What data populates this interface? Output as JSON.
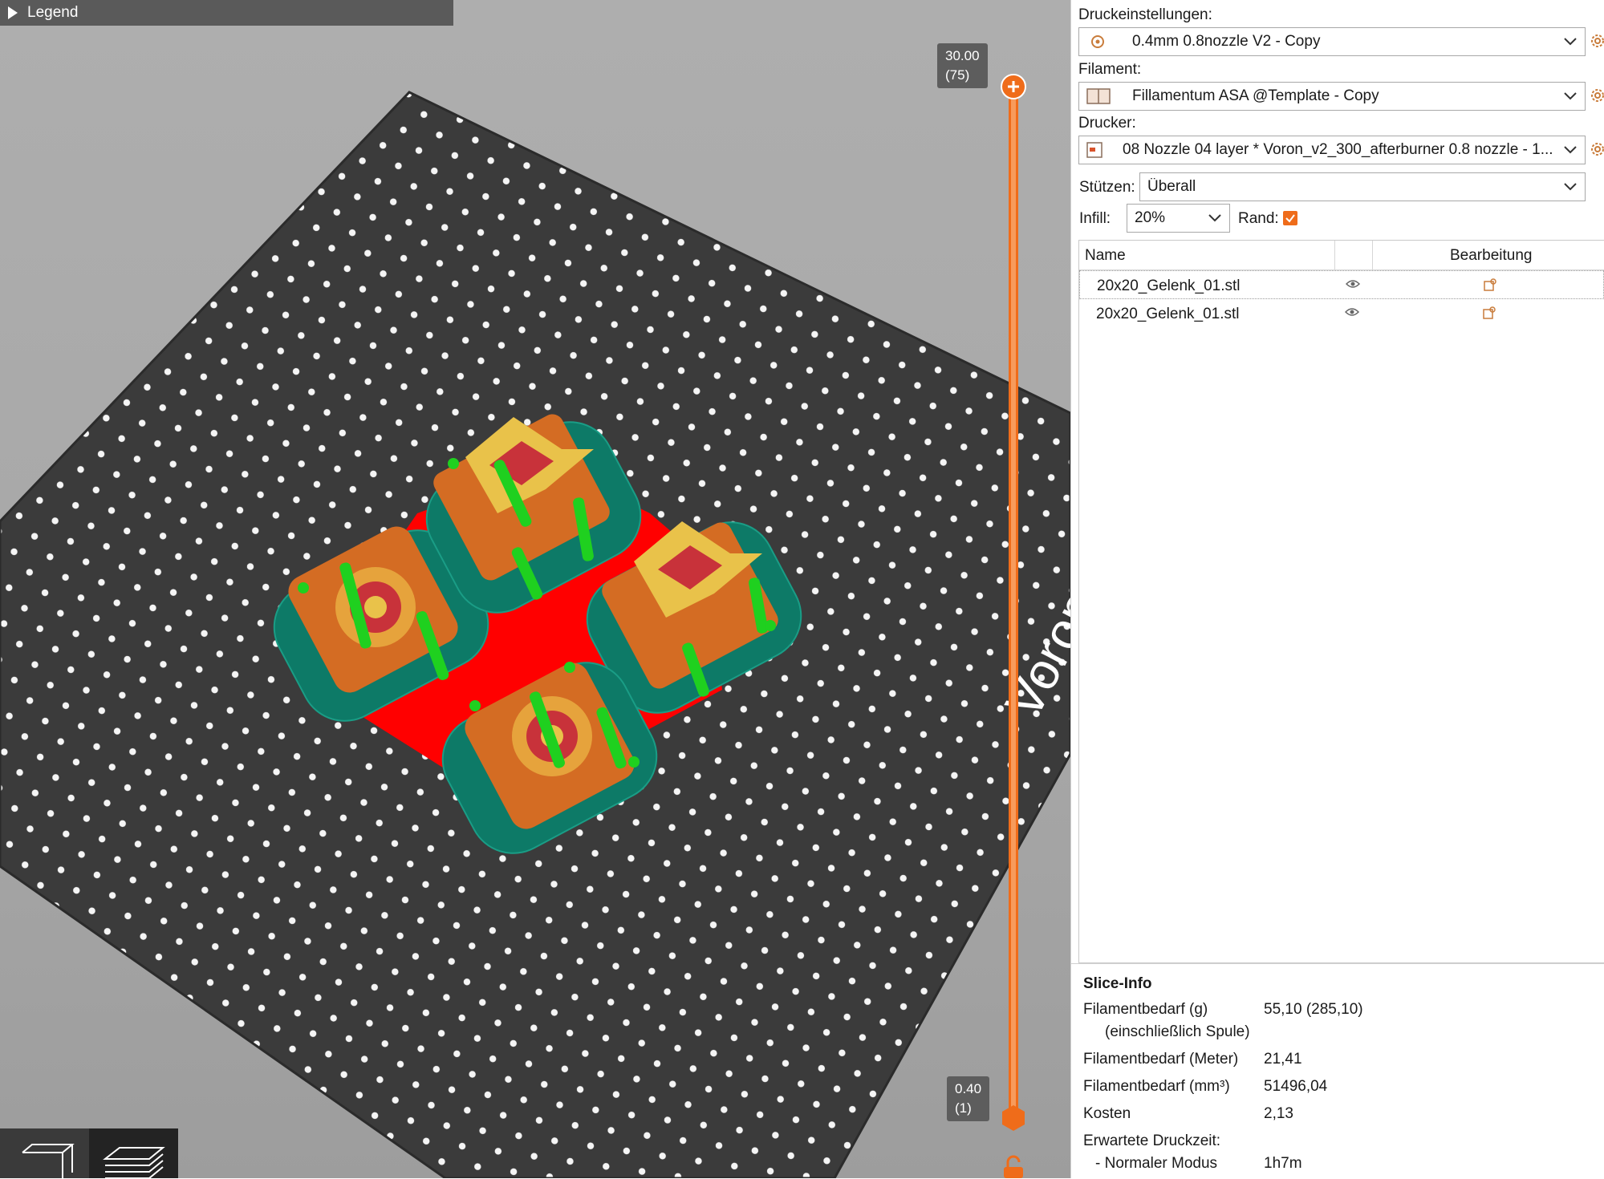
{
  "viewport": {
    "legend_label": "Legend",
    "layer_top": {
      "height": "30.00",
      "index": "(75)"
    },
    "layer_bottom": {
      "height": "0.40",
      "index": "(1)"
    },
    "bed_text": "Voron",
    "view_modes": [
      "3d-view",
      "layer-view"
    ]
  },
  "colors": {
    "accent": "#ef6c1a",
    "bed": "#3b3b3b",
    "model": "#e07b2e",
    "support": "#1fd01f",
    "brim": "#0e7a68",
    "raft": "#ff0000"
  },
  "settings": {
    "print_label": "Druckeinstellungen:",
    "print_value": "0.4mm 0.8nozzle V2 - Copy",
    "filament_label": "Filament:",
    "filament_value": "Fillamentum ASA @Template - Copy",
    "printer_label": "Drucker:",
    "printer_value": "08 Nozzle 04 layer * Voron_v2_300_afterburner 0.8 nozzle - 1...",
    "supports_label": "Stützen:",
    "supports_value": "Überall",
    "infill_label": "Infill:",
    "infill_value": "20%",
    "brim_label": "Rand:"
  },
  "object_list": {
    "col_name": "Name",
    "col_edit": "Bearbeitung",
    "items": [
      {
        "name": "20x20_Gelenk_01.stl"
      },
      {
        "name": "20x20_Gelenk_01.stl"
      }
    ]
  },
  "slice_info": {
    "title": "Slice-Info",
    "rows": [
      {
        "label": "Filamentbedarf (g)",
        "value": "55,10 (285,10)"
      },
      {
        "label": "(einschließlich Spule)",
        "value": ""
      },
      {
        "label": "Filamentbedarf (Meter)",
        "value": "21,41"
      },
      {
        "label": "Filamentbedarf (mm³)",
        "value": "51496,04"
      },
      {
        "label": "Kosten",
        "value": "2,13"
      },
      {
        "label": "Erwartete Druckzeit:",
        "value": ""
      },
      {
        "label": "- Normaler Modus",
        "value": "1h7m"
      }
    ]
  }
}
